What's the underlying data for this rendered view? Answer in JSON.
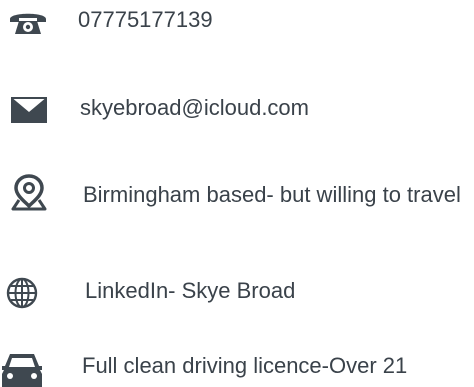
{
  "contact": {
    "phone": {
      "icon": "phone-icon",
      "text": "07775177139"
    },
    "email": {
      "icon": "envelope-icon",
      "text": "skyebroad@icloud.com"
    },
    "location": {
      "icon": "map-pin-icon",
      "text": "Birmingham based- but willing to travel"
    },
    "linkedin": {
      "icon": "globe-icon",
      "text": " LinkedIn- Skye Broad"
    },
    "driving": {
      "icon": "car-icon",
      "text": "Full clean driving licence-Over 21"
    }
  },
  "colors": {
    "icon": "#3f4850",
    "text": "#3a424a",
    "background": "#ffffff"
  }
}
